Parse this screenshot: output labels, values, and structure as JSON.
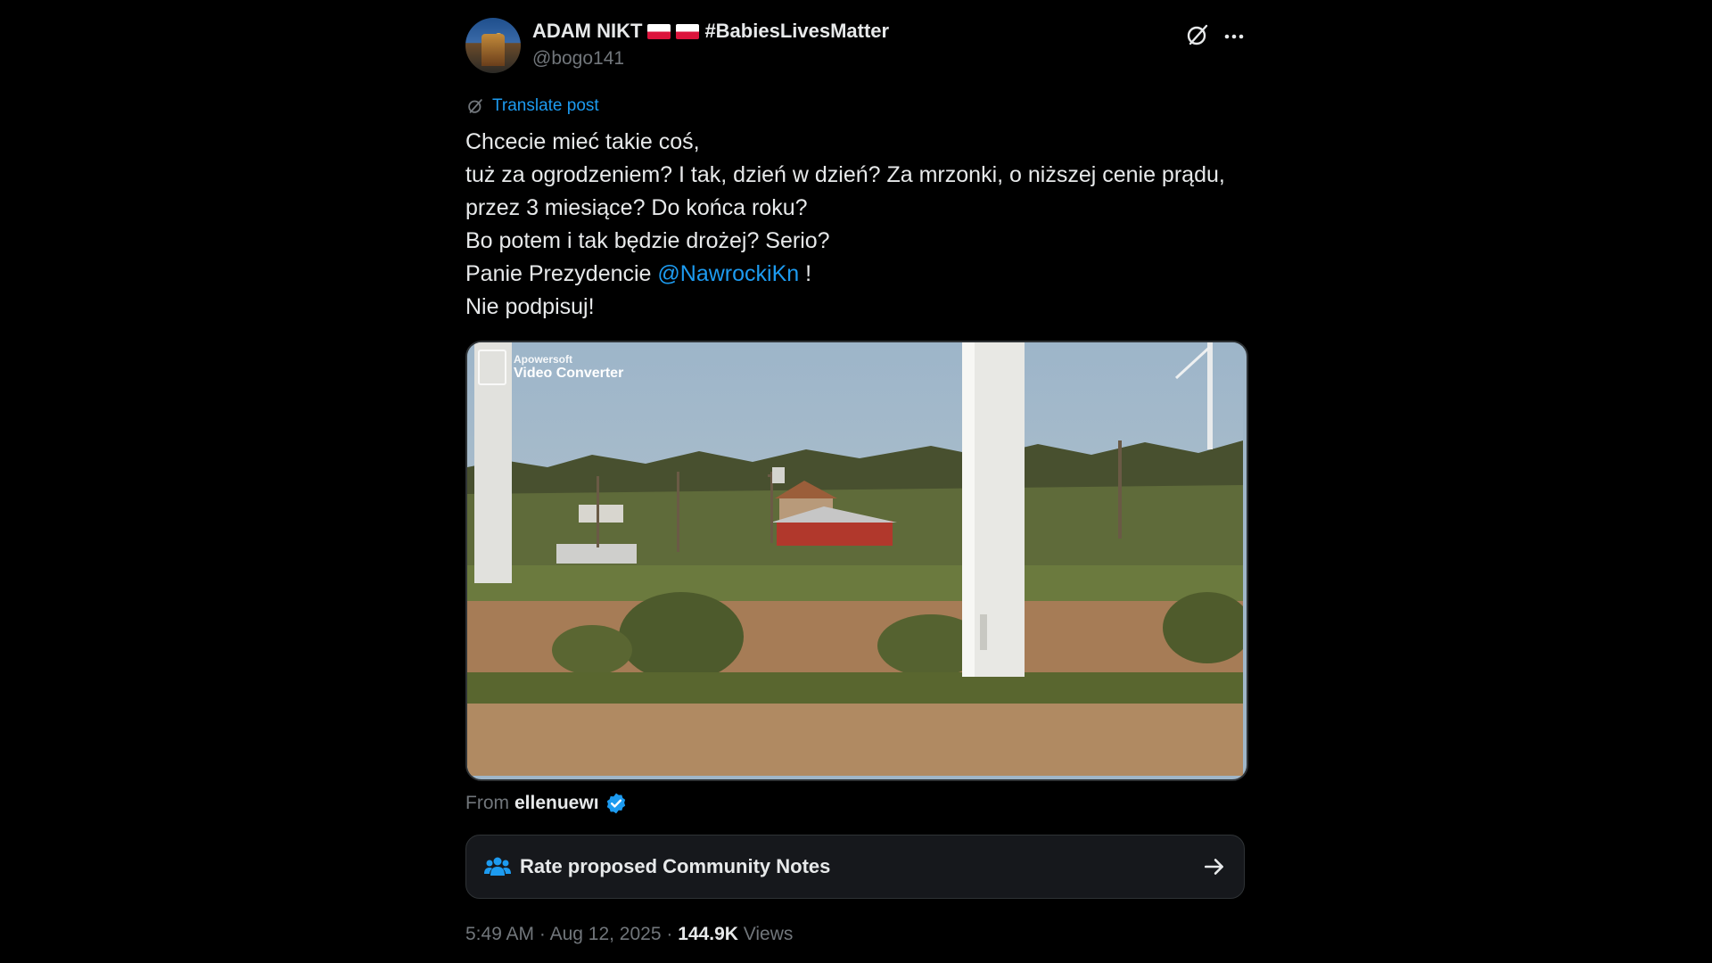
{
  "author": {
    "name": "ADAM NIKT",
    "hashtag": "#BabiesLivesMatter",
    "handle": "@bogo141"
  },
  "translate_label": "Translate post",
  "post": {
    "lines": [
      "Chcecie mieć takie coś,",
      "tuż za ogrodzeniem? I tak, dzień w dzień? Za mrzonki, o niższej cenie prądu, przez 3 miesiące? Do końca roku?",
      "Bo potem i tak będzie drożej? Serio?"
    ],
    "line4_prefix": "Panie Prezydencie ",
    "mention": "@NawrockiKn",
    "line4_suffix": " !",
    "line5": "Nie podpisuj!"
  },
  "media": {
    "watermark_top": "Apowersoft",
    "watermark_bottom": "Video Converter"
  },
  "from": {
    "label": "From",
    "source": "ellenuewı"
  },
  "community_notes": {
    "label": "Rate proposed Community Notes"
  },
  "meta": {
    "time": "5:49 AM",
    "date": "Aug 12, 2025",
    "views_count": "144.9K",
    "views_label": "Views"
  },
  "colors": {
    "background": "#000000",
    "accent": "#1d9bf0",
    "text": "#e7e9ea",
    "muted": "#71767b"
  }
}
